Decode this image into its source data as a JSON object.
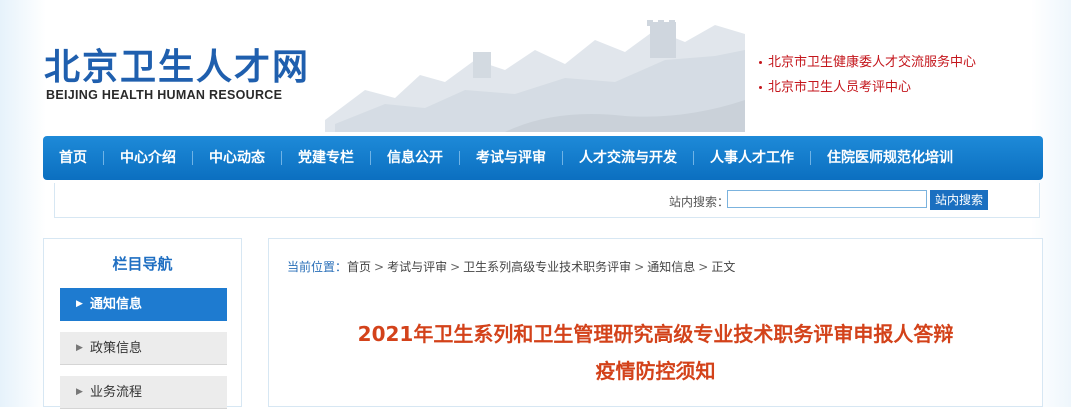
{
  "site": {
    "title_cn": "北京卫生人才网",
    "title_en": "BEIJING HEALTH HUMAN RESOURCE"
  },
  "header_links": [
    "北京市卫生健康委人才交流服务中心",
    "北京市卫生人员考评中心"
  ],
  "nav": [
    "首页",
    "中心介绍",
    "中心动态",
    "党建专栏",
    "信息公开",
    "考试与评审",
    "人才交流与开发",
    "人事人才工作",
    "住院医师规范化培训"
  ],
  "search": {
    "label": "站内搜索：",
    "button": "站内搜索",
    "value": ""
  },
  "sidebar": {
    "title": "栏目导航",
    "items": [
      "通知信息",
      "政策信息",
      "业务流程"
    ],
    "active_index": 0
  },
  "breadcrumb": {
    "label": "当前位置：",
    "items": [
      "首页",
      "考试与评审",
      "卫生系列高级专业技术职务评审",
      "通知信息",
      "正文"
    ]
  },
  "article": {
    "title_line1": "2021年卫生系列和卫生管理研究高级专业技术职务评审申报人答辩",
    "title_line2": "疫情防控须知"
  },
  "colors": {
    "nav_blue": "#1379c9",
    "title_red": "#d3421a",
    "link_red": "#c4161c",
    "logo_blue": "#1f5fae"
  }
}
